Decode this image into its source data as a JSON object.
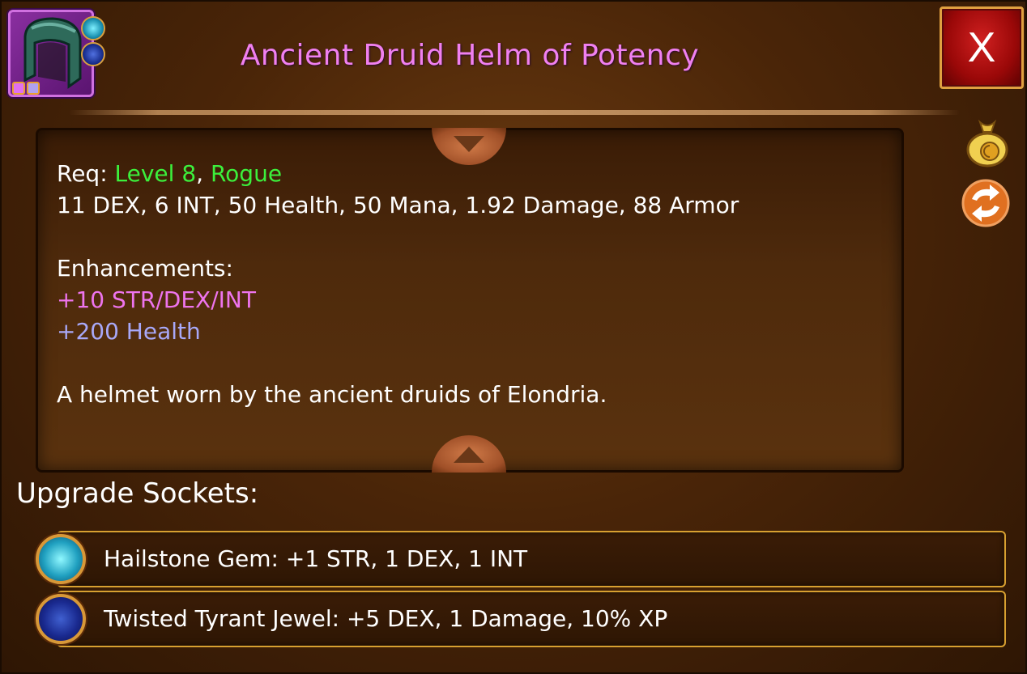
{
  "item": {
    "title": "Ancient Druid Helm of Potency",
    "icon": "druid-helm-icon",
    "rarity_color": "#f080f0",
    "gem_slots": [
      "hailstone-gem-icon",
      "tyrant-jewel-icon"
    ]
  },
  "close_button": {
    "label": "X"
  },
  "description": {
    "req_label": "Req: ",
    "req_level": "Level 8",
    "req_sep": ", ",
    "req_class": "Rogue",
    "stats": "11 DEX, 6 INT, 50 Health, 50 Mana, 1.92 Damage, 88 Armor",
    "enhancements_label": "Enhancements:",
    "enhancement_1": "+10 STR/DEX/INT",
    "enhancement_2": "+200 Health",
    "flavor": "A helmet worn by the ancient druids of Elondria."
  },
  "side_buttons": {
    "sell_icon": "gold-bag-icon",
    "swap_icon": "swap-icon"
  },
  "sockets": {
    "title": "Upgrade Sockets:",
    "items": [
      {
        "icon": "hailstone-gem-icon",
        "text": "Hailstone Gem: +1 STR, 1 DEX, 1 INT"
      },
      {
        "icon": "tyrant-jewel-icon",
        "text": "Twisted Tyrant Jewel: +5 DEX, 1 Damage, 10% XP"
      }
    ]
  },
  "colors": {
    "requirement": "#3cf03c",
    "enhancement_1": "#ee74ee",
    "enhancement_2": "#a8a8f8",
    "close_button": "#b01010",
    "socket_border": "#d8a030"
  }
}
